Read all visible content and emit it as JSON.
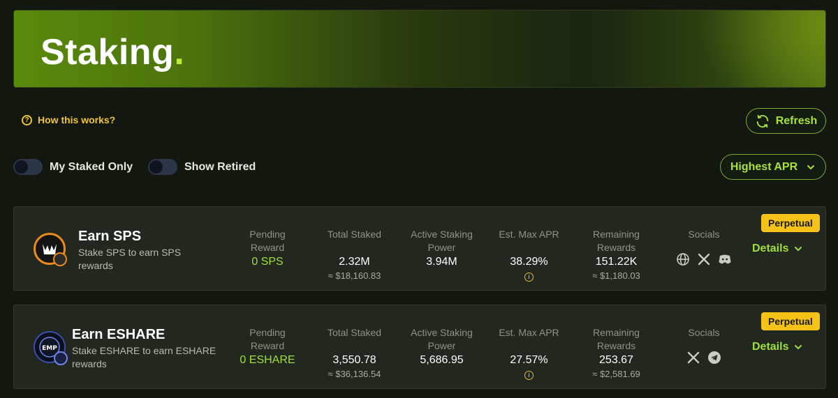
{
  "hero": {
    "title": "Staking",
    "dot": "."
  },
  "help": {
    "label": "How this works?",
    "icon": "question-circle-icon"
  },
  "refresh": {
    "label": "Refresh",
    "icon": "refresh-icon"
  },
  "filters": [
    {
      "label": "My Staked Only",
      "on": false
    },
    {
      "label": "Show Retired",
      "on": false
    }
  ],
  "sort": {
    "selected": "Highest APR",
    "icon": "chevron-down-icon"
  },
  "pools": [
    {
      "title": "Earn SPS",
      "description": "Stake SPS to earn SPS rewards",
      "pending_label": "Pending Reward",
      "pending_value": "0 SPS",
      "total_label": "Total Staked",
      "total_value": "2.32M",
      "total_usd": "≈ $18,160.83",
      "power_label": "Active Staking Power",
      "power_value": "3.94M",
      "apr_label": "Est. Max APR",
      "apr_value": "38.29%",
      "remaining_label": "Remaining Rewards",
      "remaining_value": "151.22K",
      "remaining_usd": "≈ $1,180.03",
      "socials_label": "Socials",
      "socials": [
        "globe-icon",
        "x-icon",
        "discord-icon"
      ],
      "badge": "Perpetual",
      "details": "Details"
    },
    {
      "title": "Earn ESHARE",
      "description": "Stake ESHARE to earn ESHARE rewards",
      "pending_label": "Pending Reward",
      "pending_value": "0 ESHARE",
      "total_label": "Total Staked",
      "total_value": "3,550.78",
      "total_usd": "≈ $36,136.54",
      "power_label": "Active Staking Power",
      "power_value": "5,686.95",
      "apr_label": "Est. Max APR",
      "apr_value": "27.57%",
      "remaining_label": "Remaining Rewards",
      "remaining_value": "253.67",
      "remaining_usd": "≈ $2,581.69",
      "socials_label": "Socials",
      "socials": [
        "x-icon",
        "telegram-icon"
      ],
      "badge": "Perpetual",
      "details": "Details"
    }
  ],
  "colors": {
    "accent": "#9ee03a",
    "badge": "#f5c21a",
    "warn": "#f2c43a",
    "card": "#22271f"
  }
}
